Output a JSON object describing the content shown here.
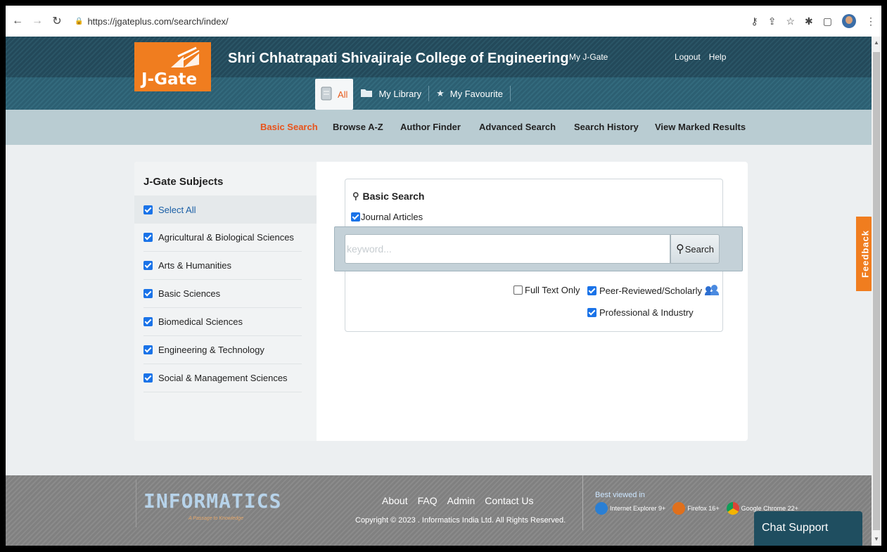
{
  "browser": {
    "url": "https://jgateplus.com/search/index/"
  },
  "header": {
    "logo_text": "J-Gate",
    "college": "Shri Chhatrapati Shivajiraje College of Engineering",
    "my_jgate": "My J-Gate",
    "logout": "Logout",
    "help": "Help",
    "tabs": [
      {
        "label": "All"
      },
      {
        "label": "My Library"
      },
      {
        "label": "My Favourite"
      }
    ]
  },
  "subnav": [
    "Basic Search",
    "Browse A-Z",
    "Author Finder",
    "Advanced Search",
    "Search History",
    "View Marked Results"
  ],
  "sidebar": {
    "title": "J-Gate Subjects",
    "items": [
      "Select All",
      "Agricultural & Biological Sciences",
      "Arts & Humanities",
      "Basic Sciences",
      "Biomedical Sciences",
      "Engineering & Technology",
      "Social & Management Sciences"
    ]
  },
  "search": {
    "title": "Basic Search",
    "journal_articles": "Journal Articles",
    "placeholder": "keyword...",
    "button": "Search",
    "full_text_only": "Full Text Only",
    "peer_reviewed": "Peer-Reviewed/Scholarly",
    "professional": "Professional & Industry"
  },
  "feedback": "Feedback",
  "footer": {
    "logo": "INFORMATICS",
    "tagline": "A Passage to Knowledge",
    "links": [
      "About",
      "FAQ",
      "Admin",
      "Contact Us"
    ],
    "copyright": "Copyright © 2023 . Informatics India Ltd. All Rights Reserved.",
    "best_viewed": "Best viewed in",
    "browsers": [
      "Internet Explorer 9+",
      "Firefox 16+",
      "Google Chrome 22+"
    ]
  },
  "chat": "Chat Support",
  "colors": {
    "accent": "#f07d1f",
    "header": "#2a5566",
    "link": "#1a5fa6"
  }
}
